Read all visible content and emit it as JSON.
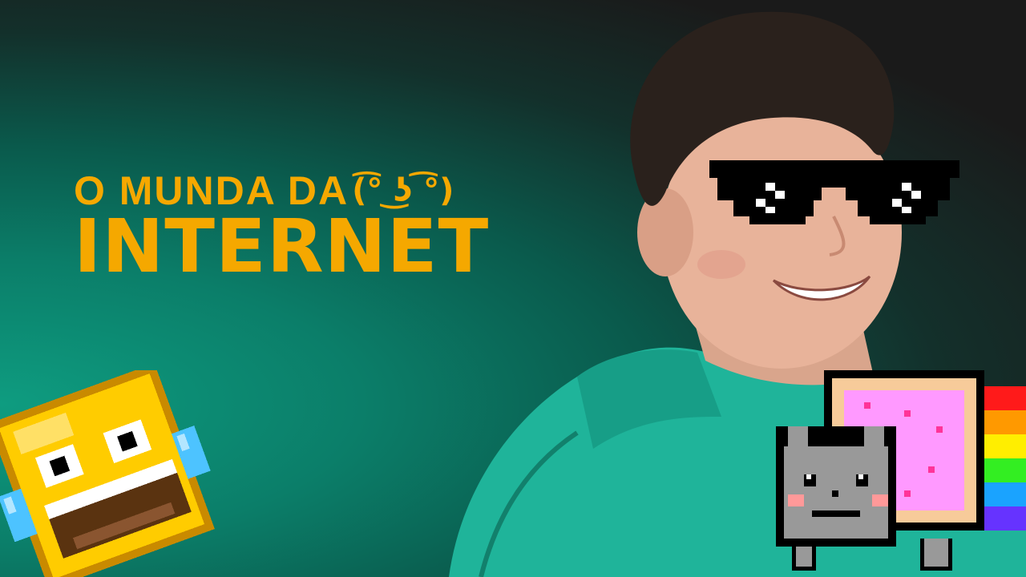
{
  "title": {
    "line1": "O MUNDA DA",
    "face": "(͡° ͜ʖ ͡°)",
    "line2": "INTERNET"
  },
  "icons": {
    "sunglasses": "pixel-sunglasses-icon",
    "nyan_cat": "nyan-cat-icon",
    "laughing_emoji": "pixel-laughing-emoji-icon"
  },
  "colors": {
    "title": "#f5a800",
    "background_teal": "#0e9c80",
    "background_dark": "#1a1a1a",
    "hoodie": "#1fb49a"
  }
}
